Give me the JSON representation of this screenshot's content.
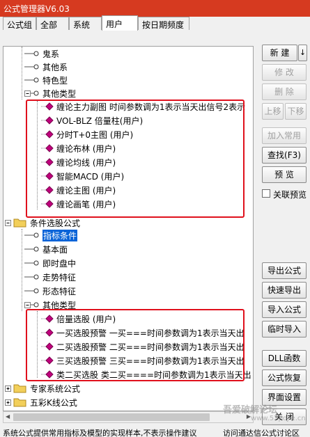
{
  "window": {
    "title": "公式管理器V6.03"
  },
  "tabs": [
    {
      "label": "公式组"
    },
    {
      "label": "全部"
    },
    {
      "label": "系统"
    },
    {
      "label": "用户"
    },
    {
      "label": "按日期频度"
    }
  ],
  "tree": {
    "rows": [
      {
        "label": "鬼系"
      },
      {
        "label": "其他系"
      },
      {
        "label": "特色型"
      },
      {
        "label": "其他类型"
      },
      {
        "label": "缠论主力副图  时间参数调为1表示当天出信号2表示"
      },
      {
        "label": "VOL-BLZ  倍量柱(用户)"
      },
      {
        "label": "分时T+0主图  (用户)"
      },
      {
        "label": "缠论布林  (用户)"
      },
      {
        "label": "缠论均线  (用户)"
      },
      {
        "label": "智能MACD  (用户)"
      },
      {
        "label": "缠论主图  (用户)"
      },
      {
        "label": "缠论画笔  (用户)"
      },
      {
        "label": "条件选股公式"
      },
      {
        "label": "指标条件"
      },
      {
        "label": "基本面"
      },
      {
        "label": "即时盘中"
      },
      {
        "label": "走势特征"
      },
      {
        "label": "形态特征"
      },
      {
        "label": "其他类型"
      },
      {
        "label": "倍量选股  (用户)"
      },
      {
        "label": "一买选股预警  一买===时间参数调为1表示当天出"
      },
      {
        "label": "二买选股预警  二买===时间参数调为1表示当天出"
      },
      {
        "label": "三买选股预警  三买===时间参数调为1表示当天出"
      },
      {
        "label": "类二买选股  类二买====时间参数调为1表示当天出"
      },
      {
        "label": "专家系统公式"
      },
      {
        "label": "五彩K线公式"
      }
    ]
  },
  "buttons": {
    "new": "新  建",
    "new_arrow": "↓",
    "modify": "修  改",
    "delete": "删  除",
    "up": "上移",
    "down": "下移",
    "add_common": "加入常用",
    "find": "查找(F3)",
    "preview": "预  览",
    "export": "导出公式",
    "quick_export": "快速导出",
    "import": "导入公式",
    "temp_import": "临时导入",
    "dll": "DLL函数",
    "restore": "公式恢复",
    "ui_settings": "界面设置",
    "close": "关  闭"
  },
  "linked_preview": {
    "label": "关联预览",
    "checked": false
  },
  "status": {
    "left": "系统公式提供常用指标及模型的实现样本,不表示操作建议",
    "right": "访问通达信公式讨论区"
  },
  "watermark": {
    "main": "吾爱破解论坛",
    "sub": "www.52pojie.cn"
  },
  "colors": {
    "titlebar": "#d63a20",
    "selection": "#0a64d8",
    "highlight_box": "#e0101c",
    "formula_icon": "#c0007c"
  }
}
